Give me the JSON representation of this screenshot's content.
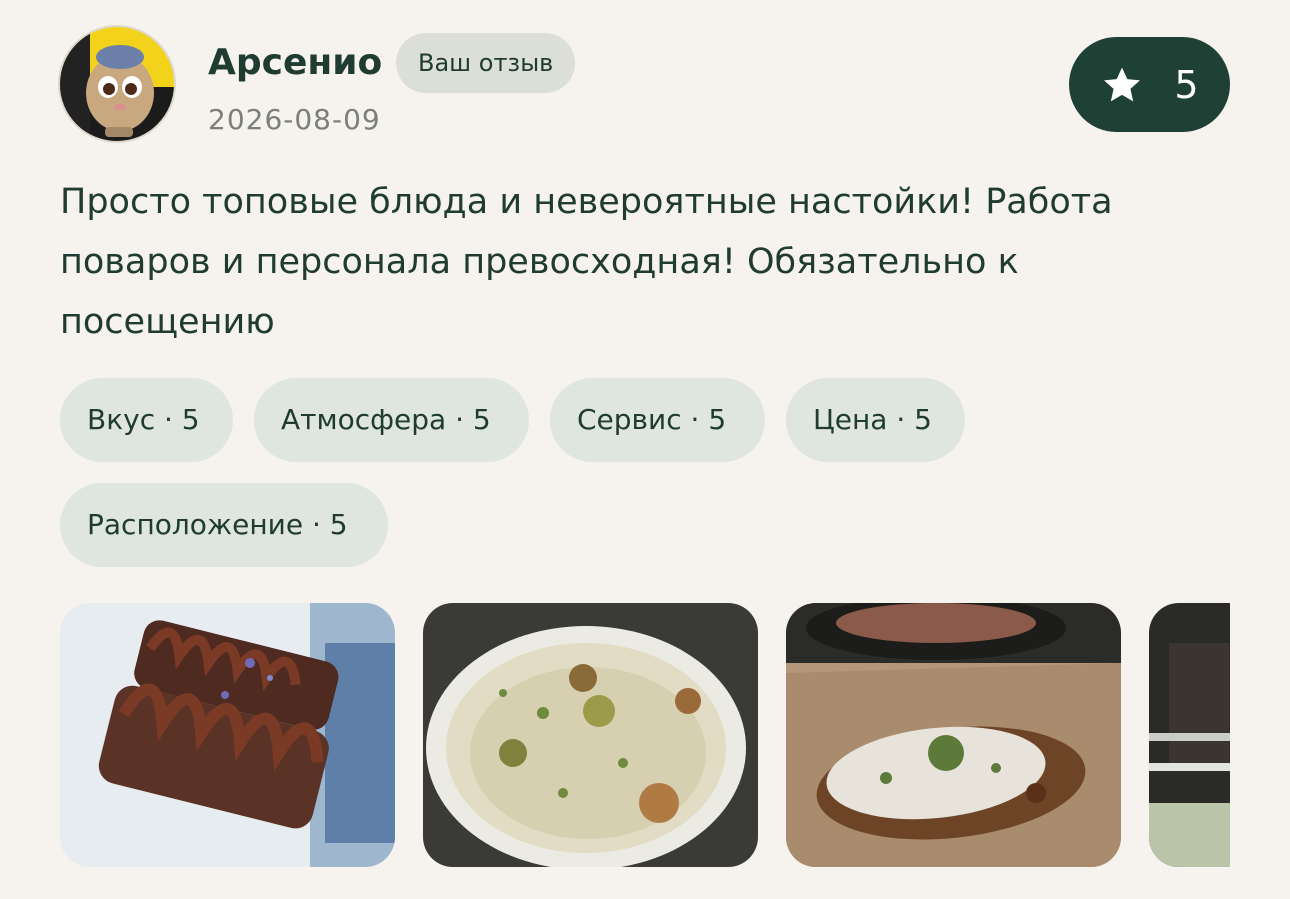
{
  "review": {
    "author_name": "Арсенио",
    "own_badge": "Ваш отзыв",
    "date": "2026-08-09",
    "rating": "5",
    "text": "Просто топовые блюда и невероятные настойки! Работа поваров и персонала превосходная! Обязательно к посещению",
    "criteria": [
      {
        "label": "Вкус · 5"
      },
      {
        "label": "Атмосфера · 5"
      },
      {
        "label": "Сервис · 5"
      },
      {
        "label": "Цена · 5"
      },
      {
        "label": "Расположение · 5"
      }
    ],
    "photos": [
      {
        "name": "chocolate-dessert-photo"
      },
      {
        "name": "cream-dish-photo"
      },
      {
        "name": "baked-dish-photo"
      },
      {
        "name": "interior-photo"
      }
    ]
  },
  "colors": {
    "background": "#f6f3ee",
    "accent": "#1f4034",
    "chip": "#dfe5df",
    "badge": "#dcdfd6",
    "text": "#1f3b32",
    "muted": "#7b7f7a"
  },
  "icons": {
    "rating": "star-icon"
  }
}
